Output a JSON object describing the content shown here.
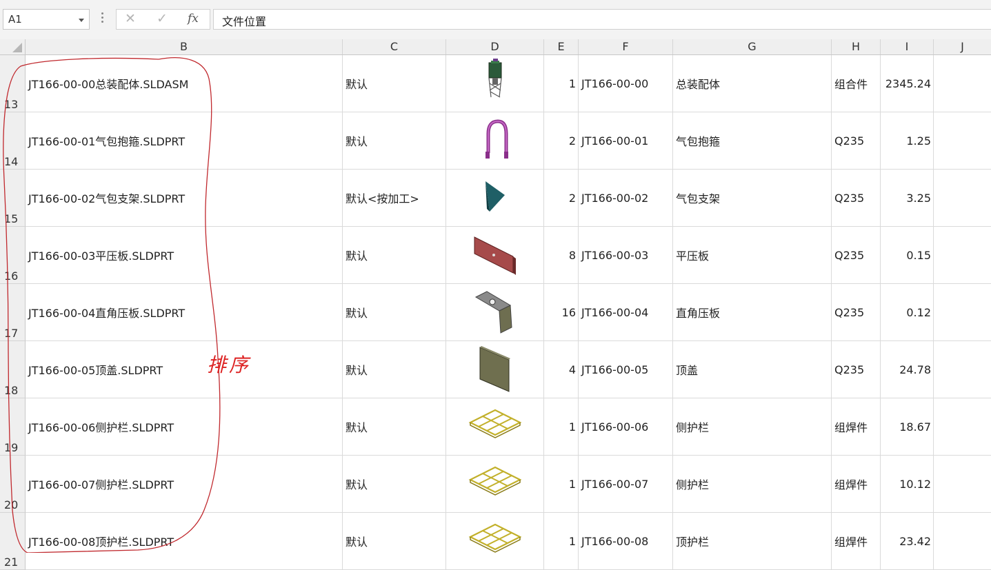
{
  "name_box": {
    "value": "A1"
  },
  "formula_bar": {
    "cancel": "✕",
    "enter": "✓",
    "fx": "fx",
    "content": "文件位置"
  },
  "columns": [
    "B",
    "C",
    "D",
    "E",
    "F",
    "G",
    "H",
    "I",
    "J"
  ],
  "rows": [
    {
      "num": "13",
      "file": "JT166-00-00总装配体.SLDASM",
      "config": "默认",
      "thumb": "assembly-thumbnail",
      "qty": "1",
      "code": "JT166-00-00",
      "name": "总装配体",
      "material": "组合件",
      "weight": "2345.24"
    },
    {
      "num": "14",
      "file": "JT166-00-01气包抱箍.SLDPRT",
      "config": "默认",
      "thumb": "hoop-thumbnail",
      "qty": "2",
      "code": "JT166-00-01",
      "name": "气包抱箍",
      "material": "Q235",
      "weight": "1.25"
    },
    {
      "num": "15",
      "file": "JT166-00-02气包支架.SLDPRT",
      "config": "默认<按加工>",
      "thumb": "bracket-thumbnail",
      "qty": "2",
      "code": "JT166-00-02",
      "name": "气包支架",
      "material": "Q235",
      "weight": "3.25"
    },
    {
      "num": "16",
      "file": "JT166-00-03平压板.SLDPRT",
      "config": "默认",
      "thumb": "flat-plate-thumbnail",
      "qty": "8",
      "code": "JT166-00-03",
      "name": "平压板",
      "material": "Q235",
      "weight": "0.15"
    },
    {
      "num": "17",
      "file": "JT166-00-04直角压板.SLDPRT",
      "config": "默认",
      "thumb": "angle-plate-thumbnail",
      "qty": "16",
      "code": "JT166-00-04",
      "name": "直角压板",
      "material": "Q235",
      "weight": "0.12"
    },
    {
      "num": "18",
      "file": "JT166-00-05顶盖.SLDPRT",
      "config": "默认",
      "thumb": "top-cover-thumbnail",
      "qty": "4",
      "code": "JT166-00-05",
      "name": "顶盖",
      "material": "Q235",
      "weight": "24.78"
    },
    {
      "num": "19",
      "file": "JT166-00-06侧护栏.SLDPRT",
      "config": "默认",
      "thumb": "side-rail-thumbnail",
      "qty": "1",
      "code": "JT166-00-06",
      "name": "侧护栏",
      "material": "组焊件",
      "weight": "18.67"
    },
    {
      "num": "20",
      "file": "JT166-00-07侧护栏.SLDPRT",
      "config": "默认",
      "thumb": "side-rail-thumbnail",
      "qty": "1",
      "code": "JT166-00-07",
      "name": "侧护栏",
      "material": "组焊件",
      "weight": "10.12"
    },
    {
      "num": "21",
      "file": "JT166-00-08顶护栏.SLDPRT",
      "config": "默认",
      "thumb": "top-rail-thumbnail",
      "qty": "1",
      "code": "JT166-00-08",
      "name": "顶护栏",
      "material": "组焊件",
      "weight": "23.42"
    }
  ],
  "annotation": {
    "text": "排序",
    "color": "#d22222"
  }
}
